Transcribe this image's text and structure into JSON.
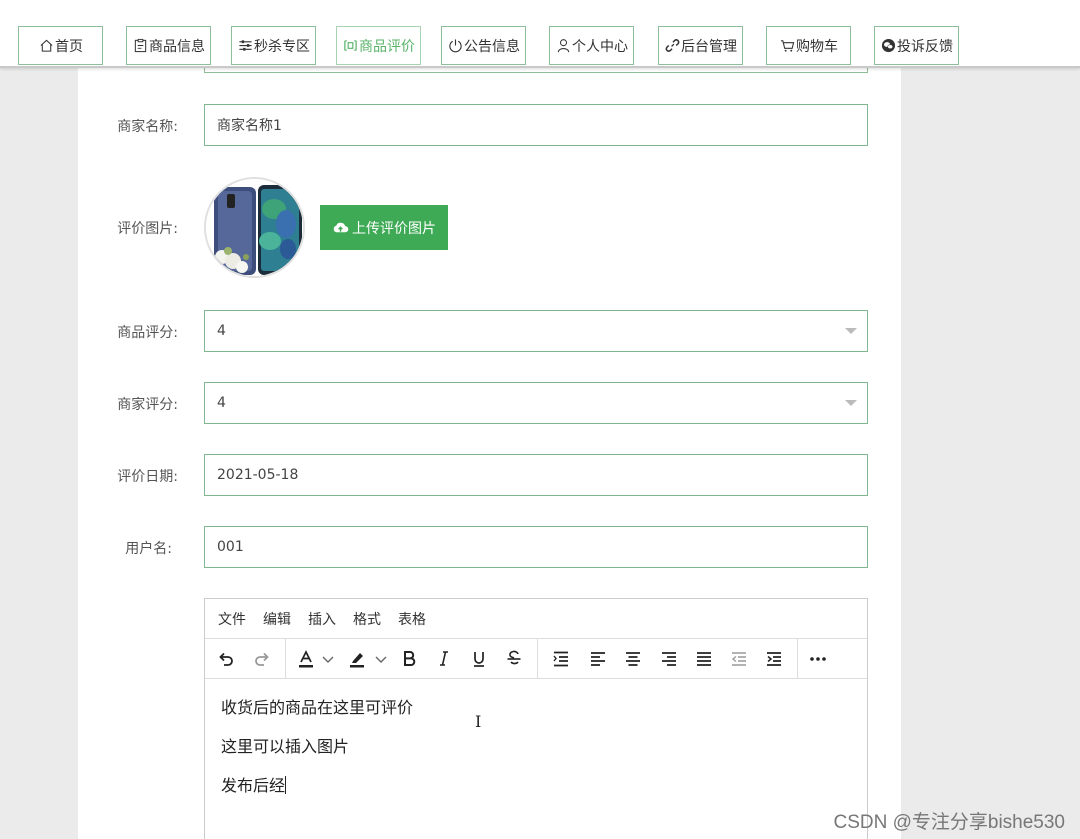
{
  "nav": [
    {
      "label": "首页",
      "icon": "home-icon"
    },
    {
      "label": "商品信息",
      "icon": "clipboard-icon"
    },
    {
      "label": "秒杀专区",
      "icon": "sliders-icon"
    },
    {
      "label": "商品评价",
      "icon": "comment-icon"
    },
    {
      "label": "公告信息",
      "icon": "power-icon"
    },
    {
      "label": "个人中心",
      "icon": "user-icon"
    },
    {
      "label": "后台管理",
      "icon": "link-icon"
    },
    {
      "label": "购物车",
      "icon": "cart-icon"
    },
    {
      "label": "投诉反馈",
      "icon": "wechat-icon"
    }
  ],
  "form": {
    "merchant_name": {
      "label": "商家名称:",
      "value": "商家名称1"
    },
    "review_image": {
      "label": "评价图片:",
      "upload_label": "上传评价图片"
    },
    "product_rating": {
      "label": "商品评分:",
      "value": "4"
    },
    "merchant_rating": {
      "label": "商家评分:",
      "value": "4"
    },
    "review_date": {
      "label": "评价日期:",
      "value": "2021-05-18"
    },
    "username": {
      "label": "用户名:",
      "value": "001"
    }
  },
  "editor": {
    "menus": [
      "文件",
      "编辑",
      "插入",
      "格式",
      "表格"
    ],
    "paragraphs": [
      "收货后的商品在这里可评价",
      "这里可以插入图片",
      "发布后经"
    ]
  },
  "watermark": "CSDN @专注分享bishe530",
  "colors": {
    "accent": "#3faa55",
    "border": "#7fb58e",
    "active_nav": "#59b36a"
  }
}
